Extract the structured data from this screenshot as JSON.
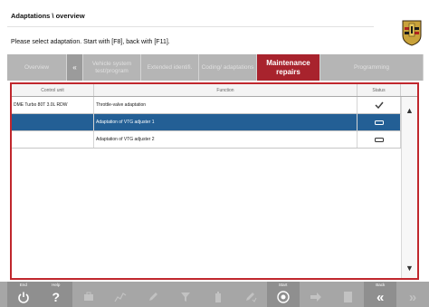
{
  "header": {
    "title": "Adaptations \\ overview",
    "instruction": "Please select adaptation. Start with [F8], back with [F11]."
  },
  "tabs": [
    {
      "label": "Overview",
      "active": false
    },
    {
      "label": "«",
      "active": false
    },
    {
      "label": "Vehicle system test/program",
      "active": false
    },
    {
      "label": "Extended identifi.",
      "active": false
    },
    {
      "label": "Coding/ adaptations",
      "active": false
    },
    {
      "label": "Maintenance repairs",
      "active": true
    },
    {
      "label": "Programming",
      "active": false
    }
  ],
  "table": {
    "columns": [
      "Control unit",
      "Function",
      "Status"
    ],
    "rows": [
      {
        "control_unit": "DME Turbo 80T 3.0L RDW",
        "function": "Throttle-valve adaptation",
        "status_icon": "checkmark-icon",
        "selected": false
      },
      {
        "control_unit": "",
        "function": "Adaptation of VTG adjuster 1",
        "status_icon": "dash-icon",
        "selected": true
      },
      {
        "control_unit": "",
        "function": "Adaptation of VTG adjuster 2",
        "status_icon": "dash-icon",
        "selected": false
      }
    ]
  },
  "function_keys": [
    {
      "label": "End",
      "icon": "power-icon",
      "enabled": true
    },
    {
      "label": "Help",
      "icon": "help-icon",
      "enabled": true
    },
    {
      "label": "",
      "icon": "tool-icon",
      "enabled": false
    },
    {
      "label": "",
      "icon": "chart-icon",
      "enabled": false
    },
    {
      "label": "",
      "icon": "edit-icon",
      "enabled": false
    },
    {
      "label": "",
      "icon": "filter-icon",
      "enabled": false
    },
    {
      "label": "",
      "icon": "battery-icon",
      "enabled": false
    },
    {
      "label": "",
      "icon": "edit-check-icon",
      "enabled": false
    },
    {
      "label": "Start",
      "icon": "start-icon",
      "enabled": true
    },
    {
      "label": "",
      "icon": "arrow-right-icon",
      "enabled": false
    },
    {
      "label": "",
      "icon": "document-icon",
      "enabled": false
    },
    {
      "label": "Back",
      "icon": "back-icon",
      "enabled": true
    },
    {
      "label": "",
      "icon": "forward-icon",
      "enabled": false
    }
  ],
  "colors": {
    "active_tab": "#a8232d",
    "selection": "#235f95",
    "panel_border": "#c0272d"
  }
}
